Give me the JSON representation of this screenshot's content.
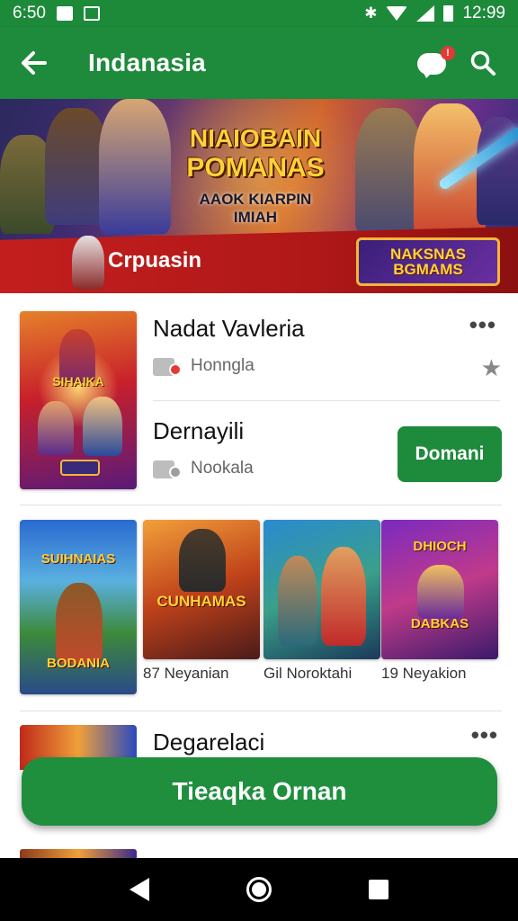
{
  "status_bar": {
    "time": "6:50",
    "battery_time": "12:99"
  },
  "app_bar": {
    "title": "Indanasia"
  },
  "banner": {
    "title_line1": "NIAIOBAIN",
    "title_line2": "POMANAS",
    "subtitle": "AAOK KIARPIN IMIAH",
    "label": "Crpuasin",
    "logo_line1": "NAKSNAS",
    "logo_line2": "BGMAMS"
  },
  "featured": {
    "name": "Nadat Vavleria",
    "meta": "Honngla",
    "art_title": "SIHAIKA",
    "name2": "Dernayili",
    "meta2": "Nookala",
    "install_label": "Domani"
  },
  "games": [
    {
      "title": "SUIHNAIAS",
      "title2": "BODANIA",
      "caption": ""
    },
    {
      "title": "CUNHAMAS",
      "caption": "87 Neyanian"
    },
    {
      "title": "",
      "caption": "Gil Noroktahi"
    },
    {
      "title": "DHIOCH",
      "title2": "DABKAS",
      "caption": "19 Neyakion"
    }
  ],
  "item3": {
    "name": "Degarelaci"
  },
  "cta": {
    "label": "Tieaqka Ornan"
  },
  "more_label": "•••"
}
